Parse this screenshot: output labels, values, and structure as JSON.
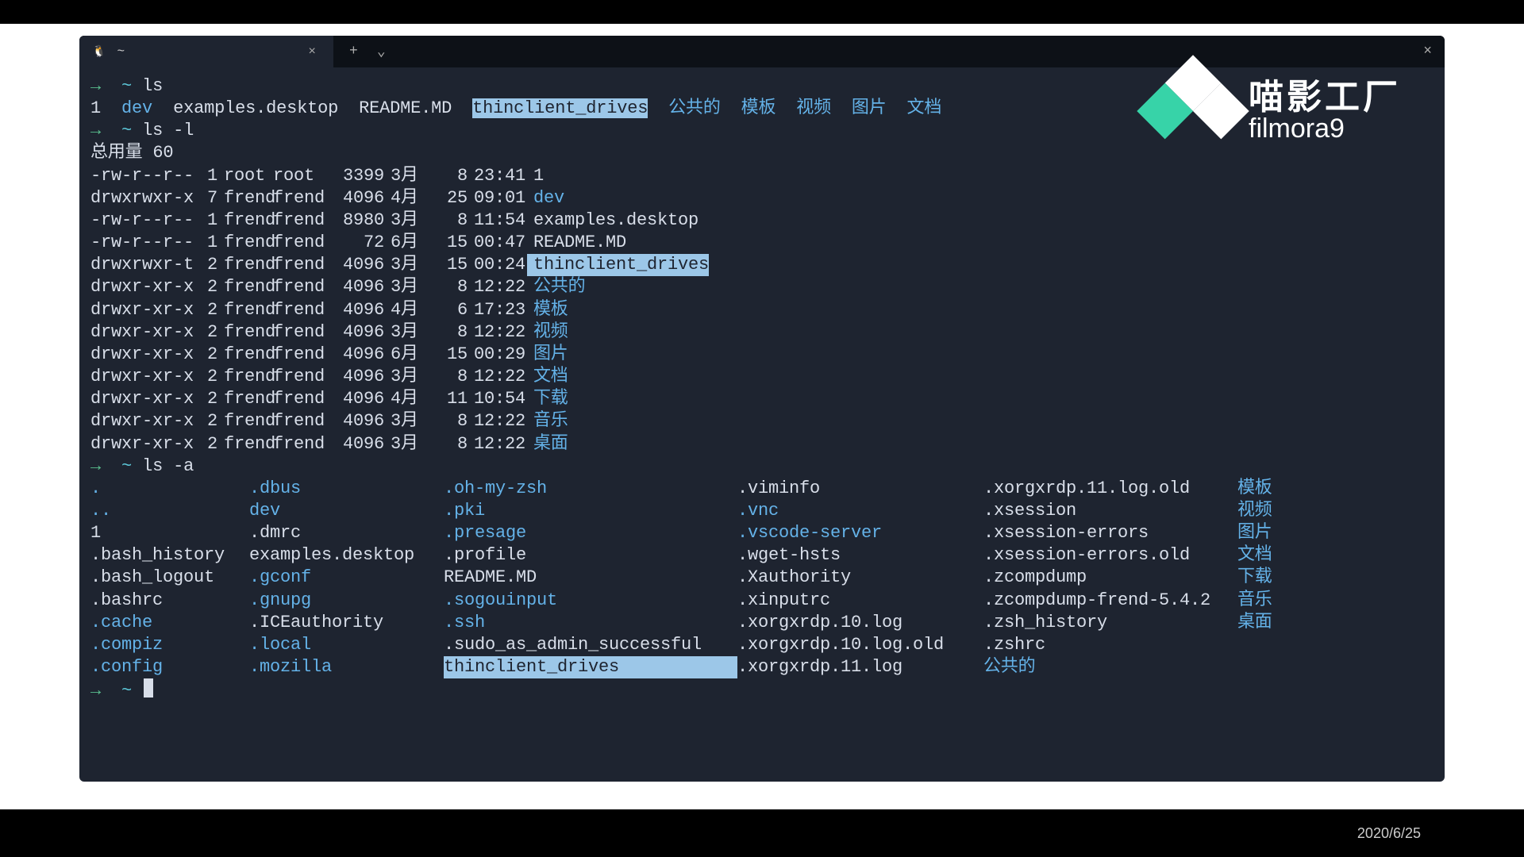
{
  "footer": {
    "date": "2020/6/25"
  },
  "watermark": {
    "main": "喵影工厂",
    "sub": "filmora9"
  },
  "tabbar": {
    "title": "~",
    "add": "+",
    "dd": "⌄",
    "close": "×",
    "win_close": "×"
  },
  "prompt": {
    "arrow": "→",
    "path": "~"
  },
  "cmds": {
    "ls": "ls",
    "lsl": "ls -l",
    "lsa": "ls -a"
  },
  "ls_out": {
    "items": [
      "1",
      "dev",
      "examples.desktop",
      "README.MD",
      "thinclient_drives",
      "公共的",
      "模板",
      "视频",
      "图片",
      "文档"
    ],
    "types": [
      "file",
      "dir",
      "file",
      "file",
      "hl",
      "cn",
      "cn",
      "cn",
      "cn",
      "cn"
    ]
  },
  "lsl": {
    "header": "总用量 60",
    "rows": [
      {
        "perm": "-rw-r--r--",
        "l": "1",
        "o": "root",
        "g": "root",
        "s": "3399",
        "m": "3月",
        "d": "8",
        "t": "23:41",
        "n": "1",
        "k": "file"
      },
      {
        "perm": "drwxrwxr-x",
        "l": "7",
        "o": "frend",
        "g": "frend",
        "s": "4096",
        "m": "4月",
        "d": "25",
        "t": "09:01",
        "n": "dev",
        "k": "dir"
      },
      {
        "perm": "-rw-r--r--",
        "l": "1",
        "o": "frend",
        "g": "frend",
        "s": "8980",
        "m": "3月",
        "d": "8",
        "t": "11:54",
        "n": "examples.desktop",
        "k": "file"
      },
      {
        "perm": "-rw-r--r--",
        "l": "1",
        "o": "frend",
        "g": "frend",
        "s": "72",
        "m": "6月",
        "d": "15",
        "t": "00:47",
        "n": "README.MD",
        "k": "file"
      },
      {
        "perm": "drwxrwxr-t",
        "l": "2",
        "o": "frend",
        "g": "frend",
        "s": "4096",
        "m": "3月",
        "d": "15",
        "t": "00:24",
        "n": "thinclient_drives",
        "k": "hl"
      },
      {
        "perm": "drwxr-xr-x",
        "l": "2",
        "o": "frend",
        "g": "frend",
        "s": "4096",
        "m": "3月",
        "d": "8",
        "t": "12:22",
        "n": "公共的",
        "k": "cn"
      },
      {
        "perm": "drwxr-xr-x",
        "l": "2",
        "o": "frend",
        "g": "frend",
        "s": "4096",
        "m": "4月",
        "d": "6",
        "t": "17:23",
        "n": "模板",
        "k": "cn"
      },
      {
        "perm": "drwxr-xr-x",
        "l": "2",
        "o": "frend",
        "g": "frend",
        "s": "4096",
        "m": "3月",
        "d": "8",
        "t": "12:22",
        "n": "视频",
        "k": "cn"
      },
      {
        "perm": "drwxr-xr-x",
        "l": "2",
        "o": "frend",
        "g": "frend",
        "s": "4096",
        "m": "6月",
        "d": "15",
        "t": "00:29",
        "n": "图片",
        "k": "cn"
      },
      {
        "perm": "drwxr-xr-x",
        "l": "2",
        "o": "frend",
        "g": "frend",
        "s": "4096",
        "m": "3月",
        "d": "8",
        "t": "12:22",
        "n": "文档",
        "k": "cn"
      },
      {
        "perm": "drwxr-xr-x",
        "l": "2",
        "o": "frend",
        "g": "frend",
        "s": "4096",
        "m": "4月",
        "d": "11",
        "t": "10:54",
        "n": "下载",
        "k": "cn"
      },
      {
        "perm": "drwxr-xr-x",
        "l": "2",
        "o": "frend",
        "g": "frend",
        "s": "4096",
        "m": "3月",
        "d": "8",
        "t": "12:22",
        "n": "音乐",
        "k": "cn"
      },
      {
        "perm": "drwxr-xr-x",
        "l": "2",
        "o": "frend",
        "g": "frend",
        "s": "4096",
        "m": "3月",
        "d": "8",
        "t": "12:22",
        "n": "桌面",
        "k": "cn"
      }
    ]
  },
  "lsa": {
    "cells": [
      {
        "n": ".",
        "k": "dir"
      },
      {
        "n": ".dbus",
        "k": "dir"
      },
      {
        "n": ".oh-my-zsh",
        "k": "dir"
      },
      {
        "n": ".viminfo",
        "k": "file"
      },
      {
        "n": ".xorgxrdp.11.log.old",
        "k": "file"
      },
      {
        "n": "模板",
        "k": "cn"
      },
      {
        "n": "..",
        "k": "dir"
      },
      {
        "n": "dev",
        "k": "dir"
      },
      {
        "n": ".pki",
        "k": "dir"
      },
      {
        "n": ".vnc",
        "k": "dir"
      },
      {
        "n": ".xsession",
        "k": "file"
      },
      {
        "n": "视频",
        "k": "cn"
      },
      {
        "n": "1",
        "k": "file"
      },
      {
        "n": ".dmrc",
        "k": "file"
      },
      {
        "n": ".presage",
        "k": "dir"
      },
      {
        "n": ".vscode-server",
        "k": "dir"
      },
      {
        "n": ".xsession-errors",
        "k": "file"
      },
      {
        "n": "图片",
        "k": "cn"
      },
      {
        "n": ".bash_history",
        "k": "file"
      },
      {
        "n": "examples.desktop",
        "k": "file"
      },
      {
        "n": ".profile",
        "k": "file"
      },
      {
        "n": ".wget-hsts",
        "k": "file"
      },
      {
        "n": ".xsession-errors.old",
        "k": "file"
      },
      {
        "n": "文档",
        "k": "cn"
      },
      {
        "n": ".bash_logout",
        "k": "file"
      },
      {
        "n": ".gconf",
        "k": "dir"
      },
      {
        "n": "README.MD",
        "k": "file"
      },
      {
        "n": ".Xauthority",
        "k": "file"
      },
      {
        "n": ".zcompdump",
        "k": "file"
      },
      {
        "n": "下载",
        "k": "cn"
      },
      {
        "n": ".bashrc",
        "k": "file"
      },
      {
        "n": ".gnupg",
        "k": "dir"
      },
      {
        "n": ".sogouinput",
        "k": "dir"
      },
      {
        "n": ".xinputrc",
        "k": "file"
      },
      {
        "n": ".zcompdump-frend-5.4.2",
        "k": "file"
      },
      {
        "n": "音乐",
        "k": "cn"
      },
      {
        "n": ".cache",
        "k": "dir"
      },
      {
        "n": ".ICEauthority",
        "k": "file"
      },
      {
        "n": ".ssh",
        "k": "dir"
      },
      {
        "n": ".xorgxrdp.10.log",
        "k": "file"
      },
      {
        "n": ".zsh_history",
        "k": "file"
      },
      {
        "n": "桌面",
        "k": "cn"
      },
      {
        "n": ".compiz",
        "k": "dir"
      },
      {
        "n": ".local",
        "k": "dir"
      },
      {
        "n": ".sudo_as_admin_successful",
        "k": "file"
      },
      {
        "n": ".xorgxrdp.10.log.old",
        "k": "file"
      },
      {
        "n": ".zshrc",
        "k": "file"
      },
      {
        "n": "",
        "k": ""
      },
      {
        "n": ".config",
        "k": "dir"
      },
      {
        "n": ".mozilla",
        "k": "dir"
      },
      {
        "n": "thinclient_drives",
        "k": "hl"
      },
      {
        "n": ".xorgxrdp.11.log",
        "k": "file"
      },
      {
        "n": "公共的",
        "k": "cn"
      },
      {
        "n": "",
        "k": ""
      }
    ]
  }
}
